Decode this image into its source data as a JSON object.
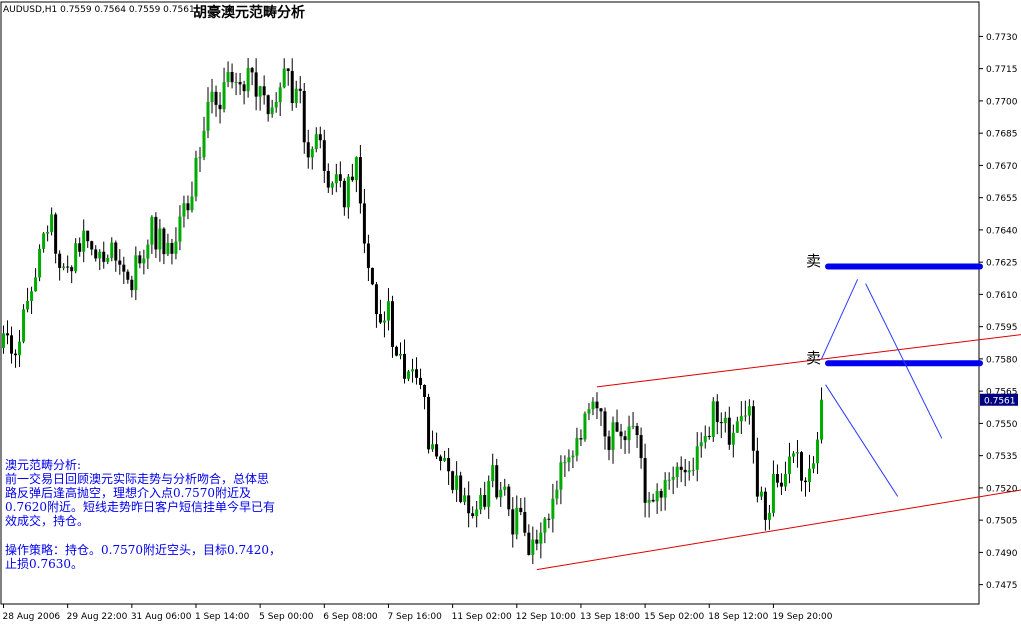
{
  "header": {
    "symbol_info": "AUDUSD,H1  0.7559 0.7564 0.7559 0.7561",
    "title": "胡豪澳元范畴分析"
  },
  "annotations": {
    "sell_label": "卖",
    "analysis_heading": "澳元范畴分析:",
    "analysis_lines": [
      "前一交易日回顾澳元实际走势与分析吻合，总体思",
      "路反弹后逢高抛空，理想介入点0.7570附近及",
      "0.7620附近。短线走势昨日客户短信挂单今早已有",
      "效成交，持仓。"
    ],
    "strategy_lines": [
      "操作策略：持仓。0.7570附近空头，目标0.7420，",
      "止损0.7630。"
    ]
  },
  "colors": {
    "bull_candle": "#00aa00",
    "bear_candle": "#000000",
    "channel": "#dd0000",
    "projection": "#2a3aff",
    "sell_level": "#0000ee",
    "price_tag_bg": "#000080"
  },
  "chart_data": {
    "type": "candlestick",
    "symbol": "AUDUSD",
    "timeframe": "H1",
    "current_price": "0.7561",
    "y_ticks": [
      "0.7730",
      "0.7715",
      "0.7700",
      "0.7685",
      "0.7670",
      "0.7655",
      "0.7640",
      "0.7625",
      "0.7610",
      "0.7595",
      "0.7580",
      "0.7565",
      "0.7550",
      "0.7535",
      "0.7520",
      "0.7505",
      "0.7490",
      "0.7475"
    ],
    "ylim": [
      0.7466,
      0.7746
    ],
    "x_ticks": [
      {
        "bar": 0,
        "label": "28 Aug 2006"
      },
      {
        "bar": 16,
        "label": "29 Aug 22:00"
      },
      {
        "bar": 32,
        "label": "31 Aug 06:00"
      },
      {
        "bar": 48,
        "label": "1 Sep 14:00"
      },
      {
        "bar": 64,
        "label": "5 Sep 00:00"
      },
      {
        "bar": 80,
        "label": "6 Sep 08:00"
      },
      {
        "bar": 96,
        "label": "7 Sep 16:00"
      },
      {
        "bar": 112,
        "label": "11 Sep 02:00"
      },
      {
        "bar": 128,
        "label": "12 Sep 10:00"
      },
      {
        "bar": 144,
        "label": "13 Sep 18:00"
      },
      {
        "bar": 160,
        "label": "15 Sep 02:00"
      },
      {
        "bar": 176,
        "label": "18 Sep 12:00"
      },
      {
        "bar": 192,
        "label": "19 Sep 20:00"
      }
    ],
    "close_path": [
      [
        0,
        0.7585
      ],
      [
        4,
        0.759
      ],
      [
        8,
        0.7625
      ],
      [
        12,
        0.764
      ],
      [
        16,
        0.762
      ],
      [
        20,
        0.7635
      ],
      [
        24,
        0.763
      ],
      [
        28,
        0.7625
      ],
      [
        31,
        0.7615
      ],
      [
        34,
        0.7625
      ],
      [
        37,
        0.764
      ],
      [
        40,
        0.763
      ],
      [
        43,
        0.764
      ],
      [
        46,
        0.765
      ],
      [
        49,
        0.768
      ],
      [
        52,
        0.77
      ],
      [
        55,
        0.7705
      ],
      [
        58,
        0.7708
      ],
      [
        61,
        0.771
      ],
      [
        64,
        0.77
      ],
      [
        67,
        0.7695
      ],
      [
        70,
        0.771
      ],
      [
        73,
        0.7705
      ],
      [
        76,
        0.768
      ],
      [
        79,
        0.7675
      ],
      [
        82,
        0.766
      ],
      [
        85,
        0.7655
      ],
      [
        88,
        0.767
      ],
      [
        90,
        0.764
      ],
      [
        92,
        0.762
      ],
      [
        94,
        0.759
      ],
      [
        96,
        0.76
      ],
      [
        99,
        0.758
      ],
      [
        102,
        0.757
      ],
      [
        104,
        0.7575
      ],
      [
        106,
        0.754
      ],
      [
        108,
        0.7535
      ],
      [
        110,
        0.753
      ],
      [
        112,
        0.752
      ],
      [
        115,
        0.7515
      ],
      [
        118,
        0.7505
      ],
      [
        121,
        0.7525
      ],
      [
        124,
        0.752
      ],
      [
        127,
        0.7505
      ],
      [
        130,
        0.75
      ],
      [
        133,
        0.749
      ],
      [
        135,
        0.75
      ],
      [
        138,
        0.7525
      ],
      [
        141,
        0.7535
      ],
      [
        144,
        0.754
      ],
      [
        146,
        0.7555
      ],
      [
        148,
        0.756
      ],
      [
        150,
        0.754
      ],
      [
        152,
        0.7545
      ],
      [
        155,
        0.755
      ],
      [
        158,
        0.754
      ],
      [
        160,
        0.752
      ],
      [
        163,
        0.7515
      ],
      [
        166,
        0.752
      ],
      [
        169,
        0.7525
      ],
      [
        172,
        0.753
      ],
      [
        175,
        0.755
      ],
      [
        178,
        0.7555
      ],
      [
        181,
        0.7545
      ],
      [
        184,
        0.7555
      ],
      [
        186,
        0.756
      ],
      [
        188,
        0.7515
      ],
      [
        190,
        0.751
      ],
      [
        192,
        0.752
      ],
      [
        195,
        0.7525
      ],
      [
        198,
        0.753
      ],
      [
        200,
        0.752
      ],
      [
        202,
        0.753
      ],
      [
        204,
        0.7561
      ]
    ],
    "channel_lines": [
      {
        "from": [
          133,
          0.7482
        ],
        "to": [
          270,
          0.7524
        ]
      },
      {
        "from": [
          148,
          0.7567
        ],
        "to": [
          270,
          0.7595
        ]
      }
    ],
    "sell_levels": [
      0.7623,
      0.7578
    ],
    "projection_lines": [
      {
        "from": [
          204,
          0.758
        ],
        "to": [
          213,
          0.7617
        ]
      },
      {
        "from": [
          215,
          0.7615
        ],
        "to": [
          234,
          0.7543
        ]
      },
      {
        "from": [
          205,
          0.7568
        ],
        "to": [
          223,
          0.7516
        ]
      }
    ]
  }
}
